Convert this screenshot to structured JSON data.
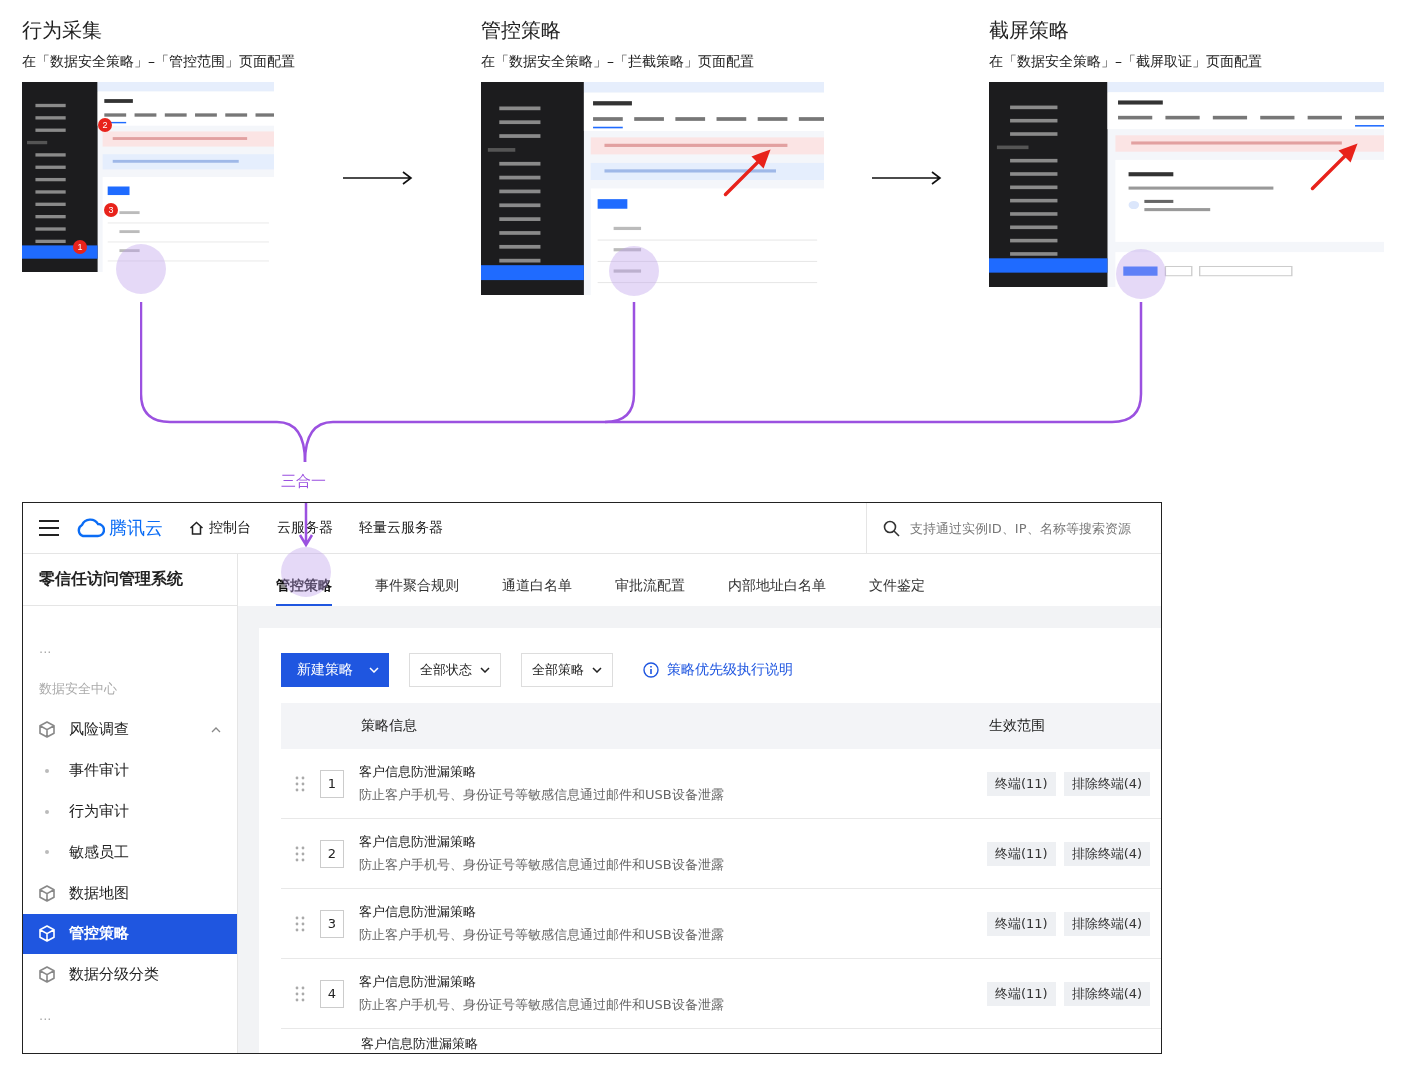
{
  "steps": [
    {
      "title": "行为采集",
      "subtitle": "在「数据安全策略」–「管控范围」页面配置",
      "kind": "table",
      "pointer": false,
      "badges": [
        "2",
        "3",
        "1"
      ]
    },
    {
      "title": "管控策略",
      "subtitle": "在「数据安全策略」–「拦截策略」页面配置",
      "kind": "table",
      "pointer": true
    },
    {
      "title": "截屏策略",
      "subtitle": "在「数据安全策略」–「截屏取证」页面配置",
      "kind": "intro",
      "pointer": true
    }
  ],
  "merge_label": "三合一",
  "console": {
    "brand": "腾讯云",
    "nav": [
      "控制台",
      "云服务器",
      "轻量云服务器"
    ],
    "search": {
      "placeholder": "支持通过实例ID、IP、名称等搜索资源"
    },
    "sidebar": {
      "title": "零信任访问管理系统",
      "items": [
        {
          "label": "...",
          "kind": "more"
        },
        {
          "label": "数据安全中心",
          "kind": "group"
        },
        {
          "label": "风险调查",
          "kind": "item",
          "selected": false,
          "expanded": true,
          "children": [
            {
              "label": "事件审计",
              "selected": false
            },
            {
              "label": "行为审计",
              "selected": false
            },
            {
              "label": "敏感员工",
              "selected": false
            }
          ]
        },
        {
          "label": "数据地图",
          "kind": "item",
          "selected": false
        },
        {
          "label": "管控策略",
          "kind": "item",
          "selected": true
        },
        {
          "label": "数据分级分类",
          "kind": "item",
          "selected": false
        },
        {
          "label": "...",
          "kind": "more"
        }
      ]
    },
    "tabs": [
      {
        "label": "管控策略",
        "selected": true
      },
      {
        "label": "事件聚合规则",
        "selected": false
      },
      {
        "label": "通道白名单",
        "selected": false
      },
      {
        "label": "审批流配置",
        "selected": false
      },
      {
        "label": "内部地址白名单",
        "selected": false
      },
      {
        "label": "文件鉴定",
        "selected": false
      }
    ],
    "toolbar": {
      "primary": "新建策略",
      "filters": [
        "全部状态",
        "全部策略"
      ],
      "link": "策略优先级执行说明"
    },
    "table": {
      "columns": [
        "策略信息",
        "生效范围"
      ],
      "rows": [
        {
          "order": "1",
          "title": "客户信息防泄漏策略",
          "desc": "防止客户手机号、身份证号等敏感信息通过邮件和USB设备泄露",
          "tags": [
            "终端(11)",
            "排除终端(4)"
          ]
        },
        {
          "order": "2",
          "title": "客户信息防泄漏策略",
          "desc": "防止客户手机号、身份证号等敏感信息通过邮件和USB设备泄露",
          "tags": [
            "终端(11)",
            "排除终端(4)"
          ]
        },
        {
          "order": "3",
          "title": "客户信息防泄漏策略",
          "desc": "防止客户手机号、身份证号等敏感信息通过邮件和USB设备泄露",
          "tags": [
            "终端(11)",
            "排除终端(4)"
          ]
        },
        {
          "order": "4",
          "title": "客户信息防泄漏策略",
          "desc": "防止客户手机号、身份证号等敏感信息通过邮件和USB设备泄露",
          "tags": [
            "终端(11)",
            "排除终端(4)"
          ]
        },
        {
          "title": "客户信息防泄漏策略"
        }
      ]
    }
  }
}
